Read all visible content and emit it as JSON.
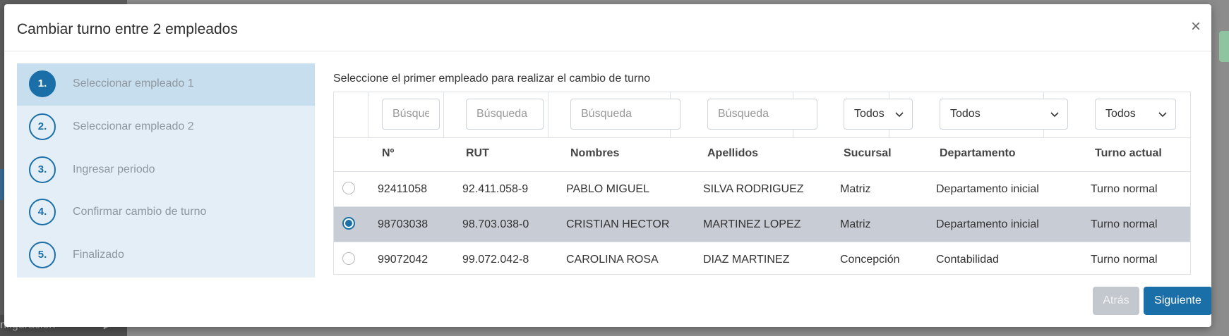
{
  "background": {
    "sidebar_footer_label": "nfiguración",
    "sidebar_footer_arrow": "▶"
  },
  "modal": {
    "title": "Cambiar turno entre 2 empleados",
    "close_glyph": "×"
  },
  "steps": [
    {
      "number": "1.",
      "label": "Seleccionar empleado 1",
      "active": true
    },
    {
      "number": "2.",
      "label": "Seleccionar empleado 2",
      "active": false
    },
    {
      "number": "3.",
      "label": "Ingresar periodo",
      "active": false
    },
    {
      "number": "4.",
      "label": "Confirmar cambio de turno",
      "active": false
    },
    {
      "number": "5.",
      "label": "Finalizado",
      "active": false
    }
  ],
  "instruction": "Seleccione el primer empleado para realizar el cambio de turno",
  "filters": {
    "numero_placeholder": "Búsqueda",
    "rut_placeholder": "Búsqueda",
    "nombres_placeholder": "Búsqueda",
    "apellidos_placeholder": "Búsqueda",
    "sucursal_value": "Todos",
    "departamento_value": "Todos",
    "turno_value": "Todos"
  },
  "columns": {
    "numero": "Nº",
    "rut": "RUT",
    "nombres": "Nombres",
    "apellidos": "Apellidos",
    "sucursal": "Sucursal",
    "departamento": "Departamento",
    "turno": "Turno actual"
  },
  "rows": [
    {
      "numero": "92411058",
      "rut": "92.411.058-9",
      "nombres": "PABLO MIGUEL",
      "apellidos": "SILVA RODRIGUEZ",
      "sucursal": "Matriz",
      "departamento": "Departamento inicial",
      "turno": "Turno normal",
      "selected": false
    },
    {
      "numero": "98703038",
      "rut": "98.703.038-0",
      "nombres": "CRISTIAN HECTOR",
      "apellidos": "MARTINEZ LOPEZ",
      "sucursal": "Matriz",
      "departamento": "Departamento inicial",
      "turno": "Turno normal",
      "selected": true
    },
    {
      "numero": "99072042",
      "rut": "99.072.042-8",
      "nombres": "CAROLINA ROSA",
      "apellidos": "DIAZ MARTINEZ",
      "sucursal": "Concepción",
      "departamento": "Contabilidad",
      "turno": "Turno normal",
      "selected": false
    }
  ],
  "buttons": {
    "back": "Atrás",
    "next": "Siguiente"
  },
  "colors": {
    "primary": "#1a6fa8",
    "step_active_bg": "#c6deed",
    "steps_bg": "#e3eef6",
    "selected_row_bg": "#c8ccd4",
    "disabled_button": "#c3c8ce"
  }
}
